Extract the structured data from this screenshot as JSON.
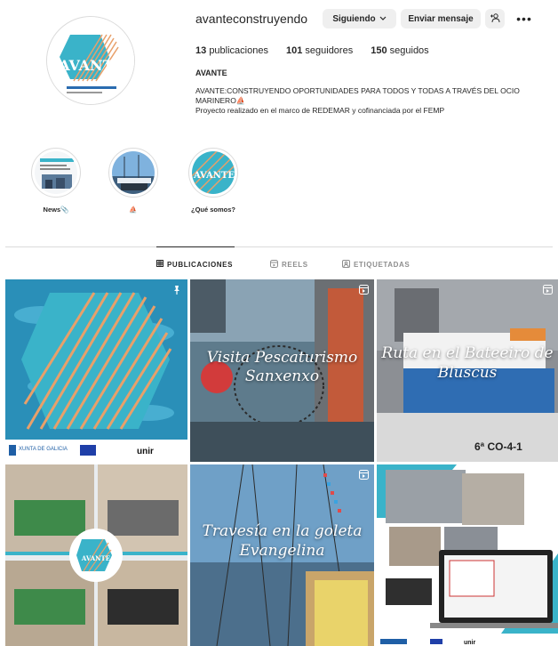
{
  "profile": {
    "username": "avanteconstruyendo",
    "follow_label": "Siguiendo",
    "message_label": "Enviar mensaje",
    "more_label": "•••",
    "stats": {
      "posts_count": "13",
      "posts_label": "publicaciones",
      "followers_count": "101",
      "followers_label": "seguidores",
      "following_count": "150",
      "following_label": "seguidos"
    },
    "full_name": "AVANTE",
    "bio_line1": "AVANTE:CONSTRUYENDO OPORTUNIDADES PARA TODOS Y TODAS A TRAVÉS DEL OCIO MARINERO⛵",
    "bio_line2": "Proyecto realizado en el marco de REDEMAR y cofinanciada por el FEMP"
  },
  "highlights": [
    {
      "label": "News📎"
    },
    {
      "label": "⛵"
    },
    {
      "label": "¿Qué somos?"
    }
  ],
  "tabs": [
    {
      "label": "PUBLICACIONES",
      "icon": "grid-icon"
    },
    {
      "label": "REELS",
      "icon": "reels-icon"
    },
    {
      "label": "ETIQUETADAS",
      "icon": "tagged-icon"
    }
  ],
  "posts": [
    {
      "caption": "",
      "logos": [
        "XUNTA DE GALICIA",
        "unir"
      ]
    },
    {
      "caption": "Visita Pescaturismo Sanxenxo"
    },
    {
      "caption": "Ruta en el Bateeiro de Bluscus"
    },
    {
      "caption": ""
    },
    {
      "caption": "Travesía en la goleta Evangelina"
    },
    {
      "caption": ""
    }
  ],
  "brand": {
    "logo_text": "AVANTE",
    "teal": "#3ab3c9",
    "orange": "#e8a06a"
  }
}
